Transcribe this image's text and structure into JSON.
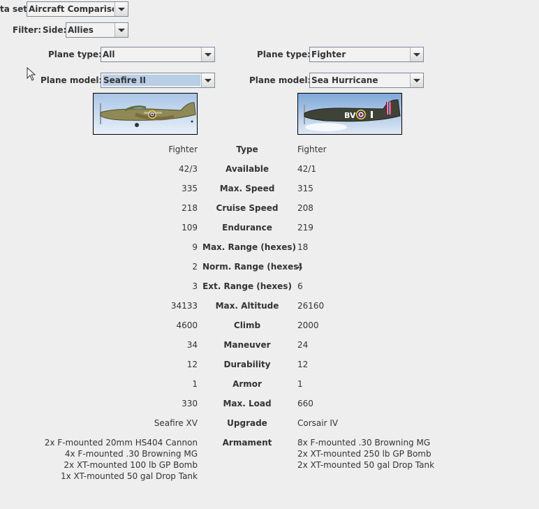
{
  "dataset": {
    "label": "ta set:",
    "value": "Aircraft Comparison"
  },
  "filter": {
    "label": "Filter:",
    "side_label": "Side:",
    "side_value": "Allies"
  },
  "left": {
    "type_label": "Plane type:",
    "type_value": "All",
    "model_label": "Plane model:",
    "model_value": "Seafire II",
    "image": "spitfire-aircraft-image"
  },
  "right": {
    "type_label": "Plane type:",
    "type_value": "Fighter",
    "model_label": "Plane model:",
    "model_value": "Sea Hurricane",
    "image": "hurricane-aircraft-image",
    "roundel_text": "BV"
  },
  "stats": [
    {
      "label": "Type",
      "left": "Fighter",
      "right": "Fighter"
    },
    {
      "label": "Available",
      "left": "42/3",
      "right": "42/1"
    },
    {
      "label": "Max. Speed",
      "left": "335",
      "right": "315"
    },
    {
      "label": "Cruise Speed",
      "left": "218",
      "right": "208"
    },
    {
      "label": "Endurance",
      "left": "109",
      "right": "219"
    },
    {
      "label": "Max. Range (hexes)",
      "left": "9",
      "right": "18"
    },
    {
      "label": "Norm. Range (hexes)",
      "left": "2",
      "right": "4"
    },
    {
      "label": "Ext. Range (hexes)",
      "left": "3",
      "right": "6"
    },
    {
      "label": "Max. Altitude",
      "left": "34133",
      "right": "26160"
    },
    {
      "label": "Climb",
      "left": "4600",
      "right": "2000"
    },
    {
      "label": "Maneuver",
      "left": "34",
      "right": "24"
    },
    {
      "label": "Durability",
      "left": "12",
      "right": "12"
    },
    {
      "label": "Armor",
      "left": "1",
      "right": "1"
    },
    {
      "label": "Max. Load",
      "left": "330",
      "right": "660"
    },
    {
      "label": "Upgrade",
      "left": "Seafire XV",
      "right": "Corsair IV"
    }
  ],
  "armament": {
    "label": "Armament",
    "left": "2x F-mounted 20mm HS404 Cannon\n4x F-mounted .30 Browning MG\n2x XT-mounted 100 lb GP Bomb\n1x XT-mounted 50 gal Drop Tank",
    "right": "8x F-mounted .30 Browning MG\n2x XT-mounted 250 lb GP Bomb\n2x XT-mounted 50 gal Drop Tank"
  },
  "colors": {
    "selection": "#b8cfe5",
    "background": "#eeeeee"
  }
}
